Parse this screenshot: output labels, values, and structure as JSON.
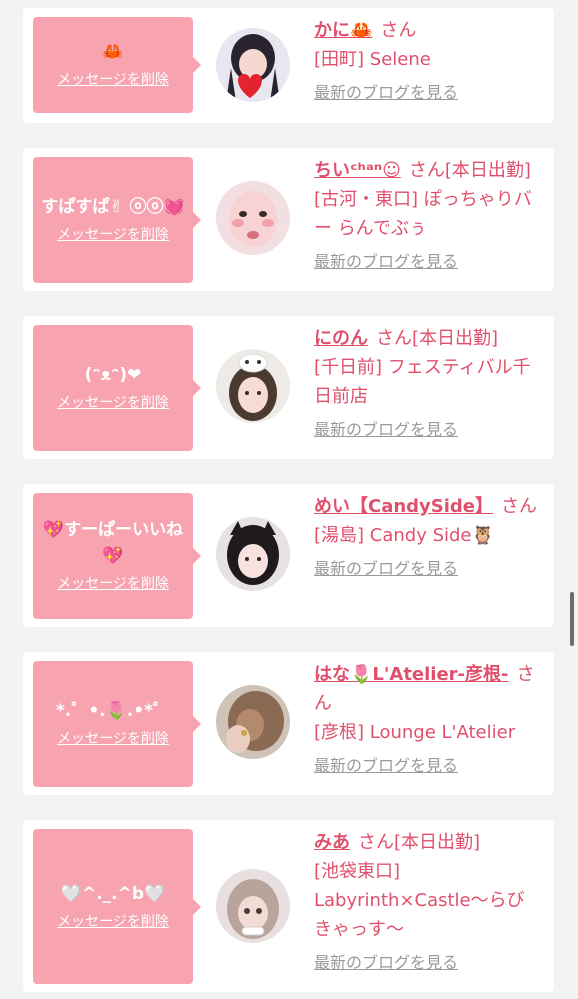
{
  "cards": [
    {
      "bubble": "🦀",
      "delete_label": "メッセージを削除",
      "name": "かに🦀",
      "suffix": "さん",
      "shop": "[田町] Selene",
      "blog": "最新のブログを見る"
    },
    {
      "bubble": "すぱすぱ✌ ⓞⓞ💓",
      "delete_label": "メッセージを削除",
      "name": "ちいᶜʰᵃⁿ☺",
      "suffix": "さん[本日出勤]",
      "shop": "[古河・東口] ぽっちゃりバー らんでぶぅ",
      "blog": "最新のブログを見る"
    },
    {
      "bubble": "(ᵔᴥᵔ)❤",
      "delete_label": "メッセージを削除",
      "name": "にのん",
      "suffix": "さん[本日出勤]",
      "shop": "[千日前] フェスティバル千日前店",
      "blog": "最新のブログを見る"
    },
    {
      "bubble": "💖すーぱーいいね💖",
      "delete_label": "メッセージを削除",
      "name": "めい【CandySide】",
      "suffix": "さん",
      "shop": "[湯島] Candy Side🦉",
      "blog": "最新のブログを見る"
    },
    {
      "bubble": "*.゜•.🌷.•*゜",
      "delete_label": "メッセージを削除",
      "name": "はな🌷L'Atelier-彦根-",
      "suffix": "さん",
      "shop": "[彦根] Lounge L'Atelier",
      "blog": "最新のブログを見る"
    },
    {
      "bubble": "🤍^._.^b🤍",
      "delete_label": "メッセージを削除",
      "name": "みあ",
      "suffix": "さん[本日出勤]",
      "shop": "[池袋東口] Labyrinth×Castle〜らびきゃっす〜",
      "blog": "最新のブログを見る"
    }
  ],
  "colors": {
    "accent": "#e0506c",
    "bubble": "#f7a3b0",
    "link_gray": "#9a9a9a"
  }
}
